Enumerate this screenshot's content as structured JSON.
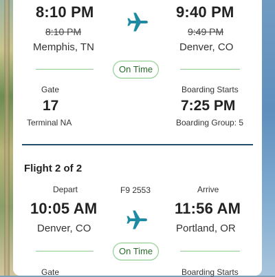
{
  "flight1": {
    "depart_time": "8:10 PM",
    "depart_sched": "8:10 PM",
    "depart_city": "Memphis, TN",
    "arrive_time": "9:40 PM",
    "arrive_sched": "9:49 PM",
    "arrive_city": "Denver, CO",
    "status": "On Time",
    "gate_label": "Gate",
    "gate": "17",
    "terminal": "Terminal NA",
    "boarding_label": "Boarding Starts",
    "boarding_time": "7:25 PM",
    "boarding_group": "Boarding Group: 5"
  },
  "flight2": {
    "title": "Flight 2 of 2",
    "depart_label": "Depart",
    "flight_number": "F9 2553",
    "arrive_label": "Arrive",
    "depart_time": "10:05 AM",
    "depart_city": "Denver, CO",
    "arrive_time": "11:56 AM",
    "arrive_city": "Portland, OR",
    "status": "On Time",
    "gate_label": "Gate",
    "boarding_label": "Boarding Starts"
  },
  "colors": {
    "plane": "#1f8aa3",
    "status_border": "#8fcb8f",
    "divider": "#1f5068"
  },
  "icons": [
    "airplane-icon"
  ]
}
